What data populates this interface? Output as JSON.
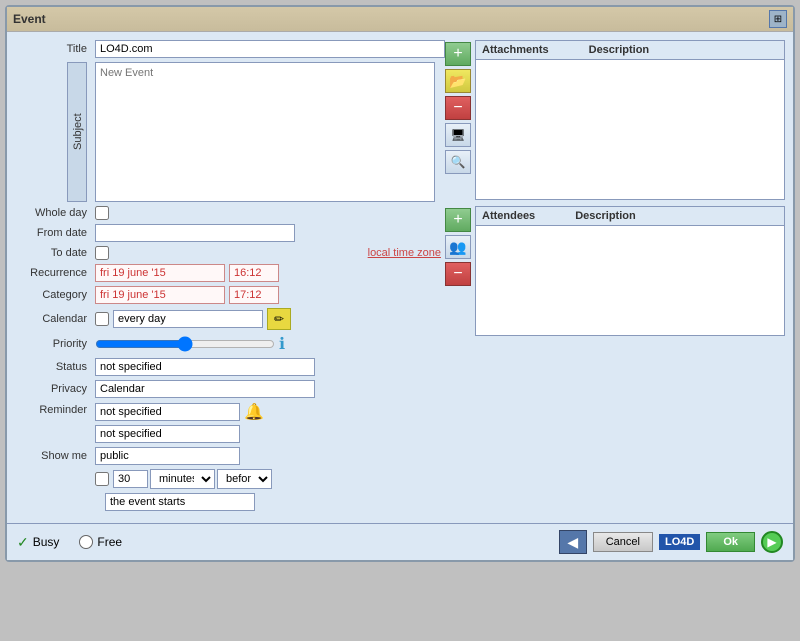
{
  "window": {
    "title": "Event"
  },
  "form": {
    "title_label": "Title",
    "title_value": "LO4D.com",
    "subject_label": "Subject",
    "subject_placeholder": "New Event",
    "whole_day_label": "Whole day",
    "from_date_label": "From date",
    "from_date_value": "",
    "to_date_label": "To date",
    "local_time_zone": "local time zone",
    "recurrence_label": "Recurrence",
    "recurrence_date1": "fri 19 june '15",
    "recurrence_time1": "16:12",
    "recurrence_date2": "fri 19 june '15",
    "recurrence_time2": "17:12",
    "category_label": "Category",
    "calendar_label": "Calendar",
    "priority_label": "Priority",
    "status_label": "Status",
    "status_value": "not specified",
    "privacy_label": "Privacy",
    "privacy_value": "Calendar",
    "reminder_label": "Reminder",
    "reminder_value1": "not specified",
    "reminder_value2": "not specified",
    "show_me_label": "Show me",
    "show_me_value": "public",
    "minutes_value": "30",
    "minutes_unit": "minutes",
    "before_value": "before",
    "event_starts": "the event starts",
    "every_day": "every day"
  },
  "attachments": {
    "label": "Attachments",
    "description_label": "Description"
  },
  "attendees": {
    "label": "Attendees",
    "description_label": "Description"
  },
  "buttons": {
    "cancel": "Cancel",
    "ok": "Ok",
    "busy_label": "Busy",
    "free_label": "Free"
  },
  "icons": {
    "add": "+",
    "remove": "−",
    "folder": "📁",
    "search": "🔍",
    "nav_prev": "◀",
    "nav_next": "▶",
    "edit": "✏",
    "check": "✓",
    "bell": "🔔"
  }
}
